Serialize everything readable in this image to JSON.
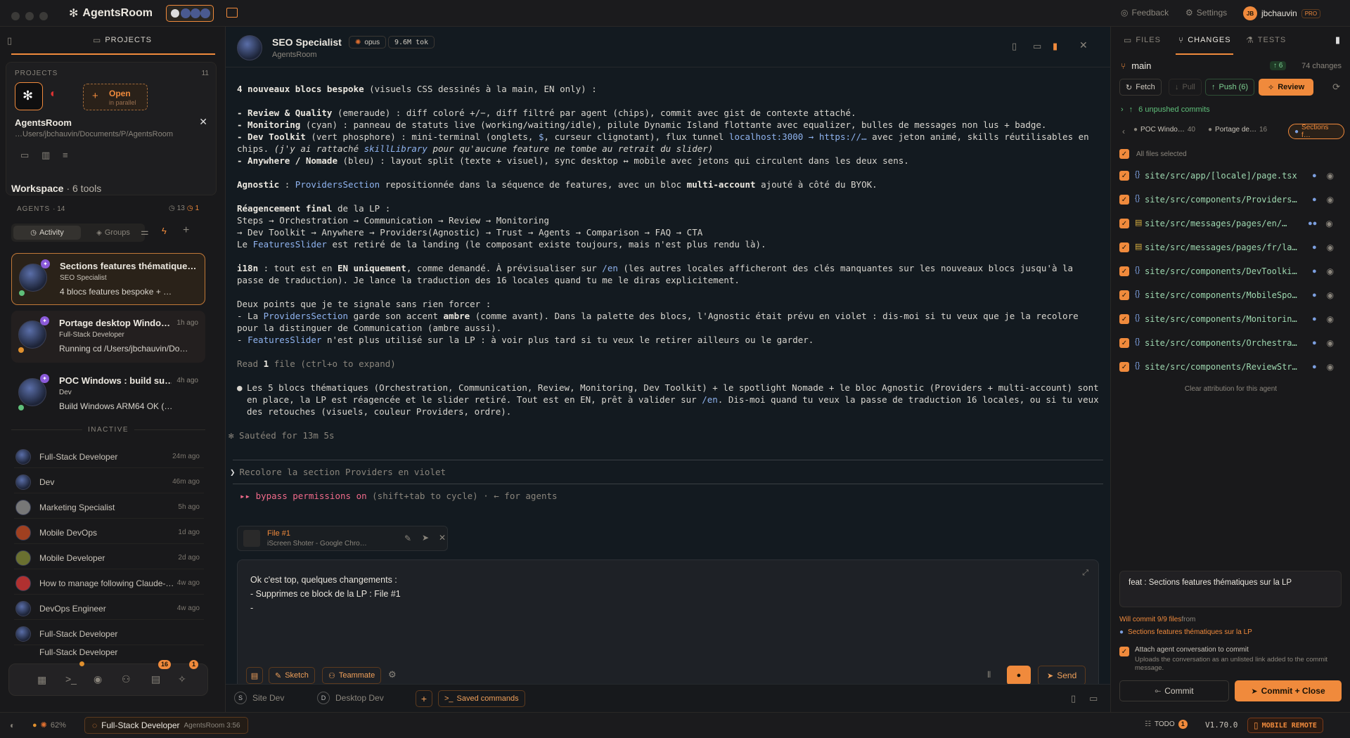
{
  "app": {
    "title": "AgentsRoom"
  },
  "titlebar": {
    "feedback": "Feedback",
    "settings": "Settings",
    "user_initials": "JB",
    "username": "jbchauvin",
    "plan": "PRO"
  },
  "projects_panel": {
    "tab_label": "PROJECTS",
    "section_label": "PROJECTS",
    "count": "11",
    "open_label": "Open",
    "open_sub": "in parallel",
    "project_name": "AgentsRoom",
    "project_path": "…Users/jbchauvin/Documents/P/AgentsRoom"
  },
  "workspace": {
    "title": "Workspace",
    "tools": "· 6 tools",
    "agents_label": "AGENTS",
    "agents_count": "· 14",
    "stat_a": "13",
    "stat_b": "1",
    "tab_activity": "Activity",
    "tab_groups": "Groups"
  },
  "active_agents": [
    {
      "title": "Sections features thématique…",
      "role": "SEO Specialist",
      "preview": "4 blocs features bespoke + …",
      "time": ""
    },
    {
      "title": "Portage desktop Windo…",
      "role": "Full-Stack Developer",
      "preview": "Running cd /Users/jbchauvin/Do…",
      "time": "1h ago"
    },
    {
      "title": "POC Windows : build su…",
      "role": "Dev",
      "preview": "Build Windows ARM64 OK (…",
      "time": "4h ago"
    }
  ],
  "inactive_label": "INACTIVE",
  "inactive_agents": [
    {
      "name": "Full-Stack Developer",
      "time": "24m ago"
    },
    {
      "name": "Dev",
      "time": "46m ago"
    },
    {
      "name": "Marketing Specialist",
      "time": "5h ago"
    },
    {
      "name": "Mobile DevOps",
      "time": "1d ago"
    },
    {
      "name": "Mobile Developer",
      "time": "2d ago"
    },
    {
      "name": "How to manage following Claude-…",
      "time": "4w ago"
    },
    {
      "name": "DevOps Engineer",
      "time": "4w ago"
    },
    {
      "name": "Full-Stack Developer",
      "time": ""
    },
    {
      "name": "Full-Stack Developer",
      "time": ""
    }
  ],
  "dock": {
    "badge_a": "16",
    "badge_b": "1"
  },
  "session": {
    "agent": "SEO Specialist",
    "model": "opus",
    "tokens": "9.6M tok",
    "project": "AgentsRoom"
  },
  "chat": {
    "l1": "4 nouveaux blocs bespoke",
    "l1b": " (visuels CSS dessinés à la main, EN only) :",
    "l2a": "- Review & Quality",
    "l2b": " (emeraude) : diff coloré +/−, diff filtré par agent (chips), commit avec gist de contexte attaché.",
    "l3a": "- Monitoring",
    "l3b": " (cyan) : panneau de statuts live (working/waiting/idle), pilule Dynamic Island flottante avec equalizer, bulles de messages non lus + badge.",
    "l4a": "- Dev Toolkit",
    "l4b": " (vert phosphore) : mini-terminal (onglets, ",
    "l4c": "$",
    "l4d": ", curseur clignotant), flux tunnel ",
    "l4e": "localhost:3000 → https://…",
    "l4f": " avec jeton animé, skills réutilisables en chips. ",
    "l4g": "(j'y ai rattaché ",
    "l4h": "skillLibrary",
    "l4i": " pour qu'aucune feature ne tombe au retrait du slider)",
    "l5a": "- Anywhere / Nomade",
    "l5b": " (bleu) : layout split (texte + visuel), sync desktop ↔ mobile avec jetons qui circulent dans les deux sens.",
    "l6a": "Agnostic",
    "l6b": " : ",
    "l6c": "ProvidersSection",
    "l6d": " repositionnée dans la séquence de features, avec un bloc ",
    "l6e": "multi-account",
    "l6f": " ajouté à côté du BYOK.",
    "l7a": "Réagencement final",
    "l7b": " de la LP :",
    "l8": "Steps → Orchestration → Communication → Review → Monitoring",
    "l9": "→ Dev Toolkit → Anywhere → Providers(Agnostic) → Trust → Agents → Comparison → FAQ → CTA",
    "l10a": "Le ",
    "l10b": "FeaturesSlider",
    "l10c": " est retiré de la landing (le composant existe toujours, mais n'est plus rendu là).",
    "l11a": "i18n",
    "l11b": " : tout est en ",
    "l11c": "EN uniquement",
    "l11d": ", comme demandé. À prévisualiser sur ",
    "l11e": "/en",
    "l11f": " (les autres locales afficheront des clés manquantes sur les nouveaux blocs jusqu'à la passe de traduction). Je lance la traduction des 16 locales quand tu me le diras explicitement.",
    "l12": "Deux points que je te signale sans rien forcer :",
    "l13a": "- La ",
    "l13b": "ProvidersSection",
    "l13c": " garde son accent ",
    "l13d": "ambre",
    "l13e": " (comme avant). Dans la palette des blocs, l'Agnostic était prévu en violet : dis-moi si tu veux que je la recolore pour la distinguer de Communication (ambre aussi).",
    "l14a": "- ",
    "l14b": "FeaturesSlider",
    "l14c": " n'est plus utilisé sur la LP : à voir plus tard si tu veux le retirer ailleurs ou le garder.",
    "l15a": "Read ",
    "l15b": "1",
    "l15c": " file (ctrl+o to expand)",
    "l16a": "Les 5 blocs thématiques (Orchestration, Communication, Review, Monitoring, Dev Toolkit) + le spotlight Nomade + le bloc Agnostic (Providers + multi-account) sont en place, la LP est réagencée et le slider retiré. Tout est en EN, prêt à valider sur ",
    "l16b": "/en",
    "l16c": ". Dis-moi quand tu veux la passe de traduction 16 locales, ou si tu veux des retouches (visuels, couleur Providers, ordre).",
    "l17": "✻ Sautéed for 13m 5s",
    "prompt_hint": "Recolore la section Providers en violet",
    "perm_a": "▸▸ bypass permissions on",
    "perm_b": " (shift+tab to cycle) · ← for agents"
  },
  "attachment": {
    "title": "File #1",
    "sub": "iScreen Shoter - Google Chro…"
  },
  "composer": {
    "line1": "Ok c'est top, quelques changements :",
    "line2": "- Supprimes ce block de la LP : File #1",
    "line3": "-",
    "sketch": "Sketch",
    "teammate": "Teammate",
    "send": "Send"
  },
  "bottom_tabs": {
    "site": "Site Dev",
    "site_initial": "S",
    "desktop": "Desktop Dev",
    "desktop_initial": "D",
    "saved": "Saved commands"
  },
  "changes": {
    "tab_files": "FILES",
    "tab_changes": "CHANGES",
    "tab_tests": "TESTS",
    "branch": "main",
    "ahead": "6",
    "changes_count": "74 changes",
    "fetch": "Fetch",
    "pull": "Pull",
    "push": "Push (6)",
    "review": "Review",
    "unpushed": "6 unpushed commits",
    "agent_tabs": [
      {
        "label": "POC Windo…",
        "count": "40"
      },
      {
        "label": "Portage de…",
        "count": "16"
      },
      {
        "label": "Sections f…",
        "count": ""
      }
    ],
    "all_files": "All files selected",
    "files": [
      "site/src/app/[locale]/page.tsx",
      "site/src/components/Providers…",
      "site/src/messages/pages/en/…",
      "site/src/messages/pages/fr/la…",
      "site/src/components/DevToolki…",
      "site/src/components/MobileSpo…",
      "site/src/components/Monitorin…",
      "site/src/components/Orchestra…",
      "site/src/components/ReviewStr…"
    ],
    "clear_attribution": "Clear attribution for this agent",
    "commit_msg": "feat : Sections features thématiques sur la LP",
    "will_commit": "Will commit 9/9 files",
    "will_commit_from": " from",
    "from_agent": "Sections features thématiques sur la LP",
    "attach_label": "Attach agent conversation to commit",
    "attach_sub": "Uploads the conversation as an unlisted link added to the commit message.",
    "commit": "Commit",
    "commit_close": "Commit + Close"
  },
  "statusbar": {
    "battery": "62%",
    "agent": "Full-Stack Developer",
    "project": "AgentsRoom 3:56",
    "todo": "TODO",
    "todo_count": "1",
    "version": "V1.70.0",
    "mobile": "MOBILE REMOTE"
  }
}
